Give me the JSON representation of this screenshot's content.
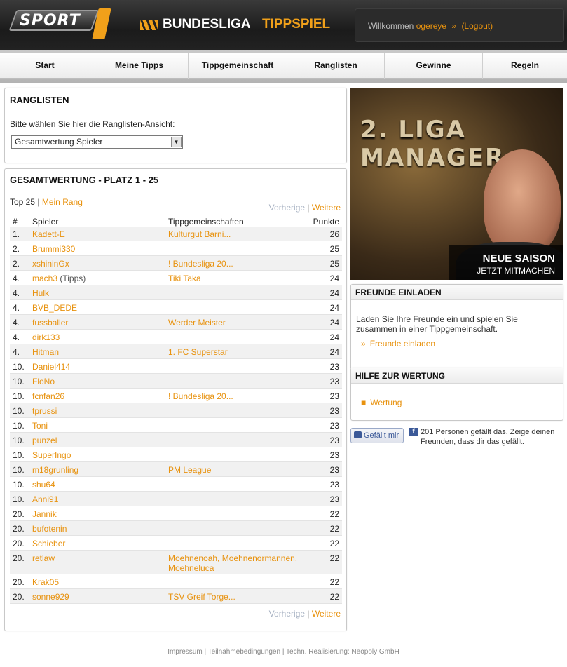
{
  "header": {
    "logo_text": "SPORT",
    "brand_left": "BUNDESLIGA",
    "brand_right": "TIPPSPIEL",
    "welcome": {
      "prefix": "Willkommen",
      "user": "ogereye",
      "arrow": "»",
      "logout": "(Logout)"
    }
  },
  "nav": [
    {
      "label": "Start",
      "active": false
    },
    {
      "label": "Meine Tipps",
      "active": false
    },
    {
      "label": "Tippgemeinschaft",
      "active": false
    },
    {
      "label": "Ranglisten",
      "active": true
    },
    {
      "label": "Gewinne",
      "active": false
    },
    {
      "label": "Regeln",
      "active": false
    }
  ],
  "ranglisten": {
    "title": "RANGLISTEN",
    "label": "Bitte wählen Sie hier die Ranglisten-Ansicht:",
    "select_value": "Gesamtwertung Spieler"
  },
  "table": {
    "title": "GESAMTWERTUNG - PLATZ 1 - 25",
    "top25": "Top 25",
    "mein_rang": "Mein Rang",
    "prev": "Vorherige",
    "next": "Weitere",
    "cols": {
      "rank": "#",
      "player": "Spieler",
      "groups": "Tippgemeinschaften",
      "points": "Punkte"
    },
    "rows": [
      {
        "rank": "1.",
        "name": "Kadett-E",
        "suffix": "",
        "groups": "Kulturgut Barni...",
        "points": "26"
      },
      {
        "rank": "2.",
        "name": "Brummi330",
        "suffix": "",
        "groups": "",
        "points": "25"
      },
      {
        "rank": "2.",
        "name": "xshininGx",
        "suffix": "",
        "groups": "! Bundesliga 20...",
        "points": "25"
      },
      {
        "rank": "4.",
        "name": "mach3",
        "suffix": "(Tipps)",
        "groups": "Tiki Taka",
        "points": "24"
      },
      {
        "rank": "4.",
        "name": "Hulk",
        "suffix": "",
        "groups": "",
        "points": "24"
      },
      {
        "rank": "4.",
        "name": "BVB_DEDE",
        "suffix": "",
        "groups": "",
        "points": "24"
      },
      {
        "rank": "4.",
        "name": "fussballer",
        "suffix": "",
        "groups": "Werder Meister",
        "points": "24"
      },
      {
        "rank": "4.",
        "name": "dirk133",
        "suffix": "",
        "groups": "",
        "points": "24"
      },
      {
        "rank": "4.",
        "name": "Hitman",
        "suffix": "",
        "groups": "1. FC Superstar",
        "points": "24"
      },
      {
        "rank": "10.",
        "name": "Daniel414",
        "suffix": "",
        "groups": "",
        "points": "23"
      },
      {
        "rank": "10.",
        "name": "FloNo",
        "suffix": "",
        "groups": "",
        "points": "23"
      },
      {
        "rank": "10.",
        "name": "fcnfan26",
        "suffix": "",
        "groups": "! Bundesliga 20...",
        "points": "23"
      },
      {
        "rank": "10.",
        "name": "tprussi",
        "suffix": "",
        "groups": "",
        "points": "23"
      },
      {
        "rank": "10.",
        "name": "Toni",
        "suffix": "",
        "groups": "",
        "points": "23"
      },
      {
        "rank": "10.",
        "name": "punzel",
        "suffix": "",
        "groups": "",
        "points": "23"
      },
      {
        "rank": "10.",
        "name": "SuperIngo",
        "suffix": "",
        "groups": "",
        "points": "23"
      },
      {
        "rank": "10.",
        "name": "m18grunling",
        "suffix": "",
        "groups": "PM League",
        "points": "23"
      },
      {
        "rank": "10.",
        "name": "shu64",
        "suffix": "",
        "groups": "",
        "points": "23"
      },
      {
        "rank": "10.",
        "name": "Anni91",
        "suffix": "",
        "groups": "",
        "points": "23"
      },
      {
        "rank": "20.",
        "name": "Jannik",
        "suffix": "",
        "groups": "",
        "points": "22"
      },
      {
        "rank": "20.",
        "name": "bufotenin",
        "suffix": "",
        "groups": "",
        "points": "22"
      },
      {
        "rank": "20.",
        "name": "Schieber",
        "suffix": "",
        "groups": "",
        "points": "22"
      },
      {
        "rank": "20.",
        "name": "retlaw",
        "suffix": "",
        "groups": "Moehnenoah, Moehnenormannen, Moehneluca",
        "points": "22"
      },
      {
        "rank": "20.",
        "name": "Krak05",
        "suffix": "",
        "groups": "",
        "points": "22"
      },
      {
        "rank": "20.",
        "name": "sonne929",
        "suffix": "",
        "groups": "TSV Greif Torge...",
        "points": "22"
      }
    ]
  },
  "banner": {
    "title": "2. LIGA MANAGER",
    "line1": "NEUE SAISON",
    "line2": "JETZT MITMACHEN"
  },
  "freunde": {
    "title": "FREUNDE EINLADEN",
    "text": "Laden Sie Ihre Freunde ein und spielen Sie zusammen in einer Tippgemeinschaft.",
    "link": "Freunde einladen"
  },
  "hilfe": {
    "title": "HILFE ZUR WERTUNG",
    "link": "Wertung"
  },
  "facebook": {
    "button": "Gefällt mir",
    "text": "201 Personen gefällt das. Zeige deinen Freunden, dass dir das gefällt."
  },
  "footer": {
    "impressum": "Impressum",
    "teilnahme": "Teilnahmebedingungen",
    "realisierung": "Techn. Realisierung: Neopoly GmbH"
  },
  "colors": {
    "accent": "#e8920e",
    "brand_orange": "#f0a01a",
    "header_bg": "#1b1b1b"
  }
}
